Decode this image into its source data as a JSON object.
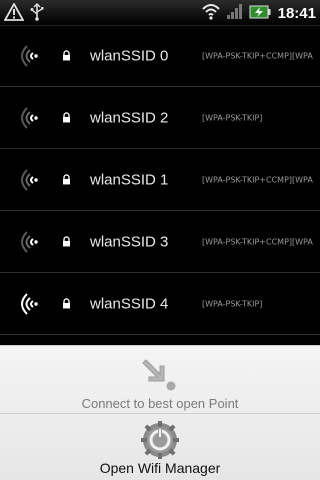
{
  "status_bar": {
    "time": "18:41",
    "left_icons": [
      "warning-icon",
      "usb-icon"
    ],
    "right_icons": [
      "wifi-signal-icon",
      "cell-signal-icon",
      "battery-charging-icon"
    ]
  },
  "networks": [
    {
      "ssid": "wlanSSID 0",
      "capabilities": "[WPA-PSK-TKIP+CCMP][WPA",
      "signal_level": 1,
      "secured": true
    },
    {
      "ssid": "wlanSSID 2",
      "capabilities": "[WPA-PSK-TKIP]",
      "signal_level": 1,
      "secured": true
    },
    {
      "ssid": "wlanSSID 1",
      "capabilities": "[WPA-PSK-TKIP+CCMP][WPA",
      "signal_level": 1,
      "secured": true
    },
    {
      "ssid": "wlanSSID 3",
      "capabilities": "[WPA-PSK-TKIP+CCMP][WPA",
      "signal_level": 1,
      "secured": true
    },
    {
      "ssid": "wlanSSID 4",
      "capabilities": "[WPA-PSK-TKIP]",
      "signal_level": 3,
      "secured": true
    }
  ],
  "menu": {
    "connect_best_label": "Connect to best open Point",
    "connect_best_icon": "arrow-to-point-icon",
    "open_manager_label": "Open Wifi Manager",
    "open_manager_icon": "wifi-manager-gear-icon"
  },
  "colors": {
    "background": "#000000",
    "sheet_background": "#eeeeee",
    "signal_strong": "#ffffff",
    "signal_weak": "#6a6a6a"
  }
}
